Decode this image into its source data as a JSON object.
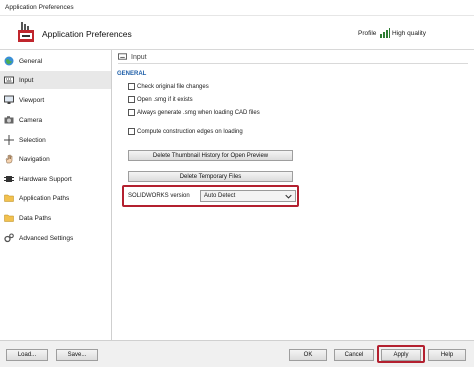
{
  "window": {
    "title": "Application Preferences"
  },
  "header": {
    "app_title": "Application Preferences",
    "profile_label": "Profile",
    "profile_value": "High quality"
  },
  "sidebar": {
    "items": [
      {
        "label": "General",
        "icon": "globe-icon",
        "active": false
      },
      {
        "label": "Input",
        "icon": "keyboard-icon",
        "active": true
      },
      {
        "label": "Viewport",
        "icon": "monitor-icon",
        "active": false
      },
      {
        "label": "Camera",
        "icon": "camera-icon",
        "active": false
      },
      {
        "label": "Selection",
        "icon": "crosshair-icon",
        "active": false
      },
      {
        "label": "Navigation",
        "icon": "hand-icon",
        "active": false
      },
      {
        "label": "Hardware Support",
        "icon": "chip-icon",
        "active": false
      },
      {
        "label": "Application Paths",
        "icon": "folder-icon",
        "active": false
      },
      {
        "label": "Data Paths",
        "icon": "folder-icon",
        "active": false
      },
      {
        "label": "Advanced Settings",
        "icon": "gears-icon",
        "active": false
      }
    ]
  },
  "main": {
    "section_title": "Input",
    "group_label": "GENERAL",
    "checkboxes": [
      {
        "label": "Check original file changes",
        "checked": false
      },
      {
        "label": "Open .smg if it exists",
        "checked": false
      },
      {
        "label": "Always generate .smg when loading CAD files",
        "checked": false
      },
      {
        "label": "Compute construction edges on loading",
        "checked": false
      }
    ],
    "delete_thumbnail_label": "Delete Thumbnail History for Open Preview",
    "delete_temp_label": "Delete Temporary Files",
    "solidworks_version_label": "SOLIDWORKS version",
    "solidworks_version_value": "Auto Detect"
  },
  "footer": {
    "load_label": "Load...",
    "save_label": "Save...",
    "ok_label": "OK",
    "cancel_label": "Cancel",
    "apply_label": "Apply",
    "help_label": "Help"
  },
  "colors": {
    "highlight": "#b3202f",
    "group_label": "#1f5fa8",
    "active_nav": "#e8e8e8"
  }
}
